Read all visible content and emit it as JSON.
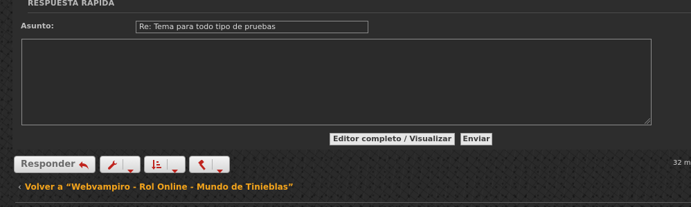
{
  "quick_reply": {
    "title": "RESPUESTA RÁPIDA",
    "subject_label": "Asunto:",
    "subject_value": "Re: Tema para todo tipo de pruebas",
    "message_value": "",
    "editor_button": "Editor completo / Visualizar",
    "send_button": "Enviar"
  },
  "actions": {
    "reply_label": "Responder",
    "reply_icon": "reply-arrow-icon",
    "tools_icon": "wrench-icon",
    "sort_icon": "sort-icon",
    "moderate_icon": "gavel-icon",
    "dropdown_icon": "caret-down-icon",
    "icon_color": "#c0241e"
  },
  "meta": {
    "post_count_text": "32 m"
  },
  "navigation": {
    "back_link": "Volver a “Webvampiro - Rol Online - Mundo de Tinieblas”"
  },
  "colors": {
    "link": "#f2a31c",
    "panel": "#2d2d2d"
  }
}
